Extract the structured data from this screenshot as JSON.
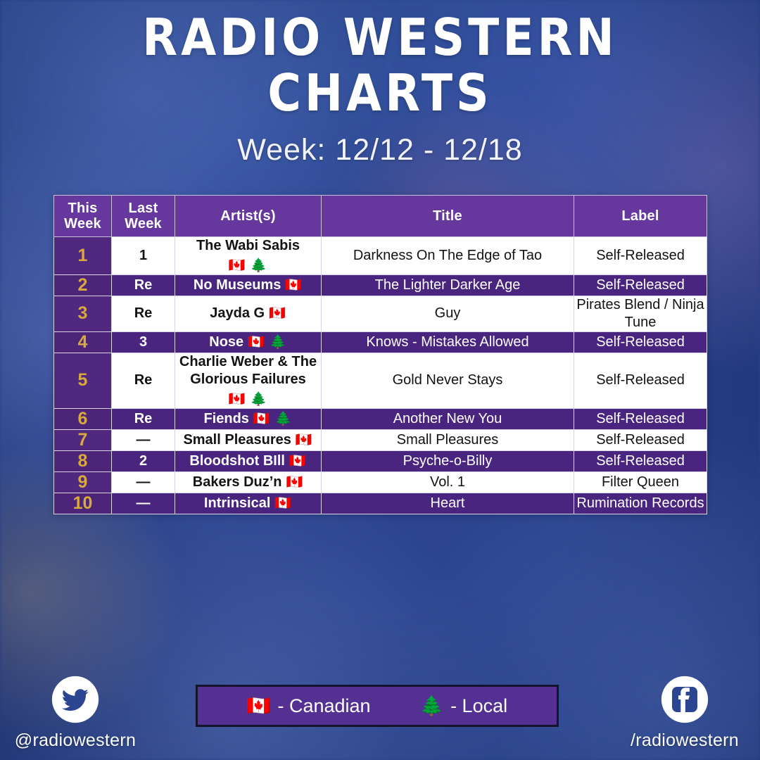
{
  "header": {
    "title_line1": "RADIO WESTERN",
    "title_line2": "CHARTS",
    "subtitle": "Week: 12/12 - 12/18"
  },
  "table": {
    "columns": {
      "this_week": "This\nWeek",
      "this_week_l1": "This",
      "this_week_l2": "Week",
      "last_week_l1": "Last",
      "last_week_l2": "Week",
      "artist": "Artist(s)",
      "title": "Title",
      "label": "Label"
    },
    "rows": [
      {
        "this_week": "1",
        "last_week": "1",
        "artist": "The Wabi Sabis",
        "flags": "🇨🇦 🌲",
        "flags_position": "below",
        "title": "Darkness On The Edge of Tao",
        "label": "Self-Released",
        "shade": "white"
      },
      {
        "this_week": "2",
        "last_week": "Re",
        "artist": "No Museums",
        "flags": "🇨🇦",
        "flags_position": "inline",
        "title": "The Lighter Darker Age",
        "label": "Self-Released",
        "shade": "alt"
      },
      {
        "this_week": "3",
        "last_week": "Re",
        "artist": "Jayda G",
        "flags": "🇨🇦",
        "flags_position": "inline",
        "title": "Guy",
        "label": "Pirates Blend / Ninja Tune",
        "shade": "white"
      },
      {
        "this_week": "4",
        "last_week": "3",
        "artist": "Nose",
        "flags": "🇨🇦 🌲",
        "flags_position": "inline",
        "title": "Knows - Mistakes Allowed",
        "label": "Self-Released",
        "shade": "alt"
      },
      {
        "this_week": "5",
        "last_week": "Re",
        "artist": "Charlie Weber & The Glorious Failures",
        "flags": "🇨🇦 🌲",
        "flags_position": "below",
        "title": "Gold Never Stays",
        "label": "Self-Released",
        "shade": "white"
      },
      {
        "this_week": "6",
        "last_week": "Re",
        "artist": "Fiends",
        "flags": "🇨🇦 🌲",
        "flags_position": "inline",
        "title": "Another New You",
        "label": "Self-Released",
        "shade": "alt"
      },
      {
        "this_week": "7",
        "last_week": "—",
        "artist": "Small Pleasures",
        "flags": "🇨🇦",
        "flags_position": "inline",
        "title": "Small Pleasures",
        "label": "Self-Released",
        "shade": "white"
      },
      {
        "this_week": "8",
        "last_week": "2",
        "artist": "Bloodshot BIll",
        "flags": "🇨🇦",
        "flags_position": "inline",
        "title": "Psyche-o-Billy",
        "label": "Self-Released",
        "shade": "alt"
      },
      {
        "this_week": "9",
        "last_week": "—",
        "artist": "Bakers Duz’n",
        "flags": "🇨🇦",
        "flags_position": "inline",
        "title": "Vol. 1",
        "label": "Filter Queen",
        "shade": "white"
      },
      {
        "this_week": "10",
        "last_week": "—",
        "artist": "Intrinsical",
        "flags": "🇨🇦",
        "flags_position": "inline",
        "title": "Heart",
        "label": "Rumination Records",
        "shade": "alt"
      }
    ]
  },
  "legend": {
    "canadian_glyph": "🇨🇦",
    "canadian_label": "- Canadian",
    "local_glyph": "🌲",
    "local_label": "- Local"
  },
  "social": {
    "twitter_handle": "@radiowestern",
    "facebook_handle": "/radiowestern"
  },
  "colors": {
    "background_blue": "#2c4a94",
    "header_purple": "#66389e",
    "rank_purple": "#50287d",
    "row_purple": "#4a2580",
    "legend_purple": "#553093",
    "rank_gold": "#d8a93f",
    "white": "#ffffff"
  }
}
